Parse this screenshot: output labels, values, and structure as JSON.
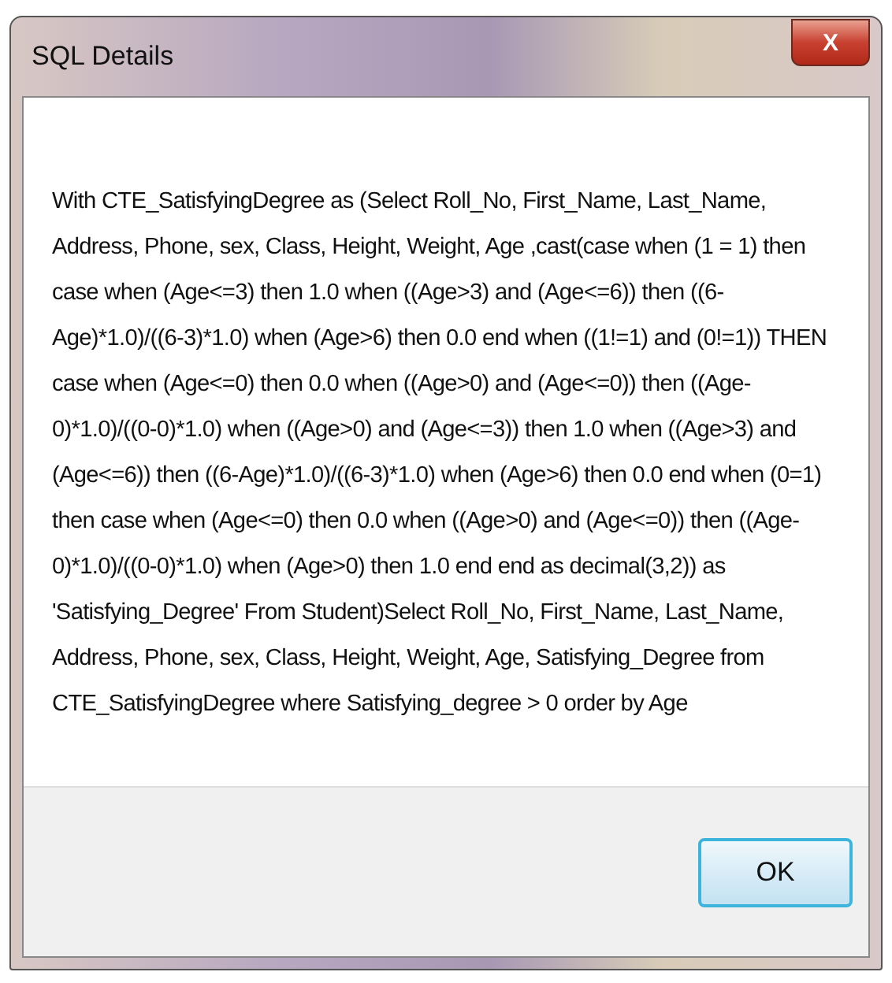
{
  "window": {
    "title": "SQL Details",
    "close_label": "X"
  },
  "message": "With CTE_SatisfyingDegree as (Select Roll_No, First_Name, Last_Name, Address, Phone, sex, Class, Height, Weight, Age ,cast(case when (1 = 1) then case when (Age<=3) then 1.0 when ((Age>3) and (Age<=6)) then ((6-Age)*1.0)/((6-3)*1.0) when (Age>6) then 0.0 end when ((1!=1) and (0!=1)) THEN case when (Age<=0) then 0.0 when ((Age>0) and (Age<=0)) then ((Age-0)*1.0)/((0-0)*1.0) when ((Age>0) and (Age<=3)) then 1.0 when ((Age>3) and (Age<=6)) then ((6-Age)*1.0)/((6-3)*1.0) when (Age>6) then 0.0 end when (0=1) then case when (Age<=0) then 0.0 when ((Age>0) and (Age<=0)) then ((Age-0)*1.0)/((0-0)*1.0) when (Age>0) then 1.0 end end as decimal(3,2)) as 'Satisfying_Degree' From Student)Select Roll_No, First_Name, Last_Name, Address, Phone, sex, Class, Height, Weight, Age, Satisfying_Degree from CTE_SatisfyingDegree where Satisfying_degree > 0 order by Age",
  "buttons": [
    {
      "label": "OK",
      "selected": true
    }
  ]
}
